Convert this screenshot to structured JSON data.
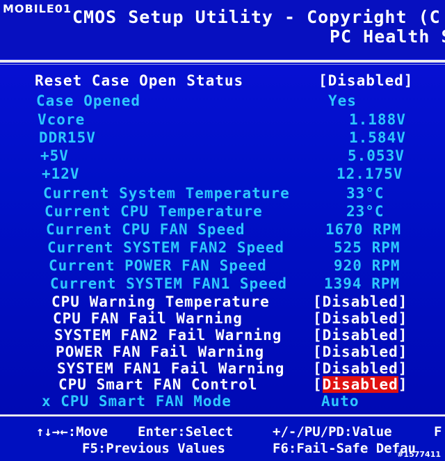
{
  "watermark": "MOBILE01",
  "watermark_id": "#1577411",
  "header": {
    "title_line1": "CMOS Setup Utility - Copyright (C",
    "title_line2": "PC Health S"
  },
  "items": [
    {
      "label": "Reset Case Open Status",
      "value": "[Disabled]",
      "style": "white"
    },
    {
      "label": "Case Opened",
      "value": "Yes",
      "style": "cyan"
    },
    {
      "label": "Vcore",
      "value": "1.188V",
      "style": "cyan"
    },
    {
      "label": "DDR15V",
      "value": "1.584V",
      "style": "cyan"
    },
    {
      "label": "+5V",
      "value": "5.053V",
      "style": "cyan"
    },
    {
      "label": "+12V",
      "value": "12.175V",
      "style": "cyan"
    },
    {
      "label": "Current System Temperature",
      "value": "33°C",
      "style": "cyan"
    },
    {
      "label": "Current CPU Temperature",
      "value": "23°C",
      "style": "cyan"
    },
    {
      "label": "Current CPU FAN Speed",
      "value": "1670 RPM",
      "style": "cyan"
    },
    {
      "label": "Current SYSTEM FAN2 Speed",
      "value": "525 RPM",
      "style": "cyan"
    },
    {
      "label": "Current POWER FAN Speed",
      "value": "920 RPM",
      "style": "cyan"
    },
    {
      "label": "Current SYSTEM FAN1 Speed",
      "value": "1394 RPM",
      "style": "cyan"
    },
    {
      "label": "CPU Warning Temperature",
      "value": "[Disabled]",
      "style": "white"
    },
    {
      "label": "CPU FAN Fail Warning",
      "value": "[Disabled]",
      "style": "white"
    },
    {
      "label": "SYSTEM FAN2 Fail Warning",
      "value": "[Disabled]",
      "style": "white"
    },
    {
      "label": "POWER FAN Fail Warning",
      "value": "[Disabled]",
      "style": "white"
    },
    {
      "label": "SYSTEM FAN1 Fail Warning",
      "value": "[Disabled]",
      "style": "white"
    },
    {
      "label": "CPU Smart FAN Control",
      "value": "Disabled",
      "style": "white",
      "selected": true
    },
    {
      "label": "x CPU Smart FAN Mode",
      "value": "Auto",
      "style": "cyan"
    }
  ],
  "footer": {
    "line1_move": "↑↓→←:Move",
    "line1_enter": "Enter:Select",
    "line1_value": "+/-/PU/PD:Value",
    "line1_f": "F",
    "line2_f5": "F5:Previous Values",
    "line2_f6": "F6:Fail-Safe Defau"
  },
  "colors": {
    "background": "#0010c8",
    "label_white": "#ffffff",
    "label_cyan": "#2ec8ff",
    "highlight": "#e01010"
  }
}
